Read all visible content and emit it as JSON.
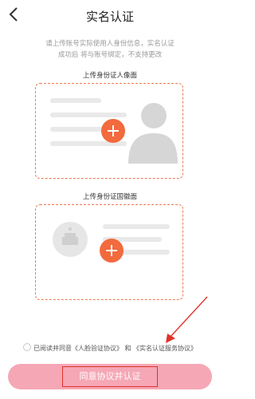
{
  "header": {
    "title": "实名认证"
  },
  "notice": {
    "line1": "请上传账号实际使用人身份信息，实名认证",
    "line2": "成功后 将与账号绑定，不支持更改"
  },
  "front_card": {
    "label": "上传身份证人像面",
    "icon": "plus-icon"
  },
  "back_card": {
    "label": "上传身份证国徽面",
    "icon": "plus-icon"
  },
  "agreement": {
    "prefix": "已阅读并同意",
    "link1": "《人脸验证协议》",
    "and": "和",
    "link2": "《实名认证服务协议》"
  },
  "submit": {
    "label": "同意协议并认证"
  },
  "colors": {
    "accent": "#f26a3d",
    "dashed_border": "#f07a52",
    "button_bg": "#f5a7b5",
    "annotation_red": "#e0332b"
  }
}
